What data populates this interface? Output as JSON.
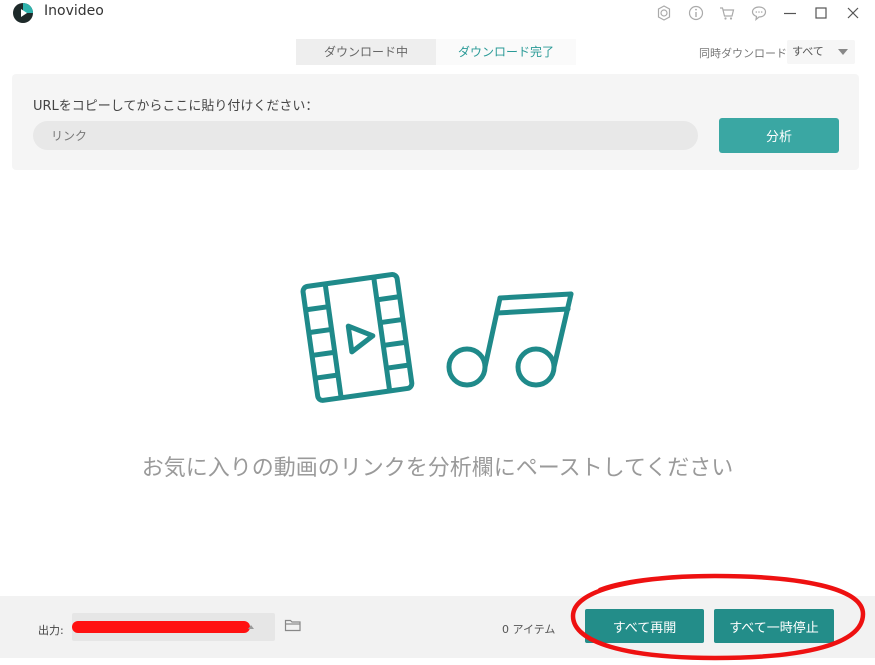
{
  "window": {
    "title": "Inovideo",
    "icons": [
      "gear-icon",
      "info-icon",
      "cart-icon",
      "chat-icon",
      "minimize-icon",
      "maximize-icon",
      "close-icon"
    ]
  },
  "tabs": [
    {
      "label": "ダウンロード中",
      "active": false
    },
    {
      "label": "ダウンロード完了",
      "active": true
    }
  ],
  "concurrent": {
    "label": "同時ダウンロード",
    "selected": "すべて"
  },
  "url_panel": {
    "label": "URLをコピーしてからここに貼り付けください：",
    "placeholder": "リンク",
    "analyze_label": "分析"
  },
  "empty_state": {
    "message": "お気に入りの動画のリンクを分析欄にペーストしてください",
    "icons": [
      "video-film-icon",
      "music-note-icon"
    ]
  },
  "bottom_bar": {
    "output_label": "出力:",
    "item_count": "0 アイテム",
    "resume_all_label": "すべて再開",
    "pause_all_label": "すべて一時停止"
  },
  "colors": {
    "accent": "#3aa7a3",
    "accent_dark": "#238d89",
    "annotation": "#ee1111"
  }
}
